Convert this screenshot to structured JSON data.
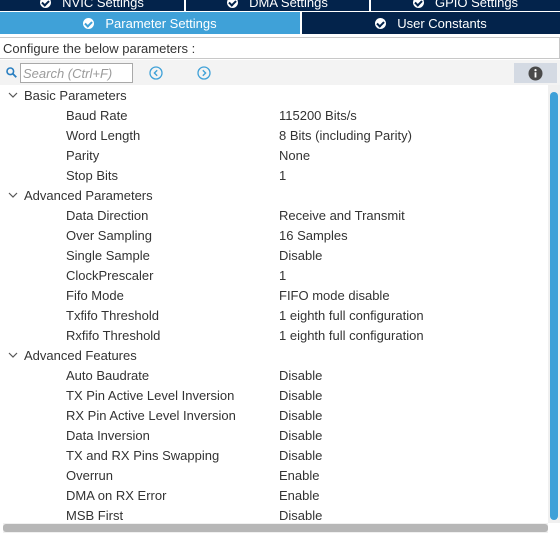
{
  "top_tabs": [
    {
      "label": "NVIC Settings"
    },
    {
      "label": "DMA Settings"
    },
    {
      "label": "GPIO Settings"
    }
  ],
  "second_tabs": [
    {
      "label": "Parameter Settings",
      "active": true
    },
    {
      "label": "User Constants",
      "active": false
    }
  ],
  "configure_text": "Configure the below parameters :",
  "search": {
    "placeholder": "Search (Ctrl+F)",
    "value": ""
  },
  "groups": [
    {
      "title": "Basic Parameters",
      "expanded": true,
      "params": [
        {
          "name": "Baud Rate",
          "value": "115200 Bits/s"
        },
        {
          "name": "Word Length",
          "value": "8 Bits (including Parity)"
        },
        {
          "name": "Parity",
          "value": "None"
        },
        {
          "name": "Stop Bits",
          "value": "1"
        }
      ]
    },
    {
      "title": "Advanced Parameters",
      "expanded": true,
      "params": [
        {
          "name": "Data Direction",
          "value": "Receive and Transmit"
        },
        {
          "name": "Over Sampling",
          "value": "16 Samples"
        },
        {
          "name": "Single Sample",
          "value": "Disable"
        },
        {
          "name": "ClockPrescaler",
          "value": "1"
        },
        {
          "name": "Fifo Mode",
          "value": "FIFO mode disable"
        },
        {
          "name": "Txfifo Threshold",
          "value": "1 eighth full configuration"
        },
        {
          "name": "Rxfifo Threshold",
          "value": "1 eighth full configuration"
        }
      ]
    },
    {
      "title": "Advanced Features",
      "expanded": true,
      "params": [
        {
          "name": "Auto Baudrate",
          "value": "Disable"
        },
        {
          "name": "TX Pin Active Level Inversion",
          "value": "Disable"
        },
        {
          "name": "RX Pin Active Level Inversion",
          "value": "Disable"
        },
        {
          "name": "Data Inversion",
          "value": "Disable"
        },
        {
          "name": "TX and RX Pins Swapping",
          "value": "Disable"
        },
        {
          "name": "Overrun",
          "value": "Enable"
        },
        {
          "name": "DMA on RX Error",
          "value": "Enable"
        },
        {
          "name": "MSB First",
          "value": "Disable"
        }
      ]
    }
  ],
  "colors": {
    "tab_dark": "#03234b",
    "tab_active": "#3fa1d8",
    "scroll_thumb": "#3fa1d8"
  },
  "icons": {
    "search": "search-icon",
    "prev": "chevron-left-circle-icon",
    "next": "chevron-right-circle-icon",
    "info": "info-icon",
    "expand": "chevron-down-icon",
    "tab_check": "check-circle-icon"
  }
}
